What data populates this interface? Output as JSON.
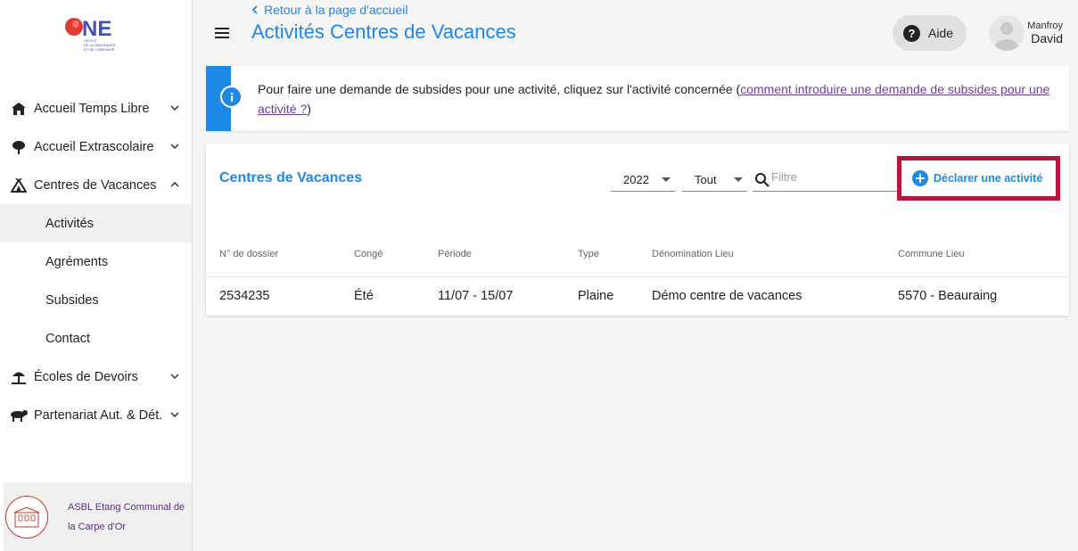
{
  "sidebar": {
    "logo_text": "ONE",
    "logo_subtitle": "OFFICE DE LA NAISSANCE ET DE L'ENFANCE",
    "items": [
      {
        "label": "Accueil Temps Libre",
        "icon": "house-icon",
        "expanded": false
      },
      {
        "label": "Accueil Extrascolaire",
        "icon": "tree-icon",
        "expanded": false
      },
      {
        "label": "Centres de Vacances",
        "icon": "tent-icon",
        "expanded": true
      },
      {
        "label": "Écoles de Devoirs",
        "icon": "beach-umbrella-icon",
        "expanded": false
      },
      {
        "label": "Partenariat Aut. & Dét.",
        "icon": "animal-icon",
        "expanded": false
      }
    ],
    "subitems": [
      "Activités",
      "Agréments",
      "Subsides",
      "Contact"
    ],
    "active_subitem": "Activités",
    "org_name": "ASBL Etang Communal de la Carpe d'Or"
  },
  "header": {
    "back_label": "Retour à la page d'accueil",
    "title": "Activités Centres de Vacances",
    "help_label": "Aide",
    "user_first": "Manfroy",
    "user_last": "David"
  },
  "banner": {
    "text": "Pour faire une demande de subsides pour une activité, cliquez sur l'activité concernée (",
    "link": "comment introduire une demande de subsides pour une activité ?",
    "text_end": ")"
  },
  "card": {
    "title": "Centres de Vacances",
    "year_select": "2022",
    "type_select": "Tout",
    "filter_placeholder": "Filtre",
    "declare_label": "Déclarer une activité",
    "columns": [
      "N° de dossier",
      "Congé",
      "Période",
      "Type",
      "Dénomination Lieu",
      "Commune Lieu"
    ],
    "rows": [
      [
        "2534235",
        "Été",
        "11/07 - 15/07",
        "Plaine",
        "Démo centre de vacances",
        "5570 - Beauraing"
      ]
    ]
  },
  "colors": {
    "accent": "#1e88e5",
    "highlight_border": "#b5163c",
    "link": "#6a3d99"
  }
}
